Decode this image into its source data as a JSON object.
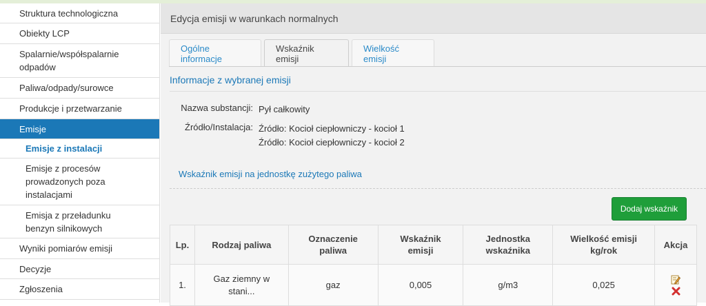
{
  "sidebar": {
    "items": [
      {
        "label": "Struktura technologiczna"
      },
      {
        "label": "Obiekty LCP"
      },
      {
        "label": "Spalarnie/współspalarnie\nodpadów"
      },
      {
        "label": "Paliwa/odpady/surowce"
      },
      {
        "label": "Produkcje i przetwarzanie"
      },
      {
        "label": "Emisje"
      },
      {
        "label": "Emisje z instalacji"
      },
      {
        "label": "Emisje z procesów\nprowadzonych poza\ninstalacjami"
      },
      {
        "label": "Emisja z przeładunku\nbenzyn silnikowych"
      },
      {
        "label": "Wyniki pomiarów emisji"
      },
      {
        "label": "Decyzje"
      },
      {
        "label": "Zgłoszenia"
      }
    ]
  },
  "main": {
    "header_title": "Edycja emisji w warunkach normalnych",
    "tabs": [
      {
        "label": "Ogólne informacje"
      },
      {
        "label": "Wskaźnik emisji"
      },
      {
        "label": "Wielkość emisji"
      }
    ],
    "section_title": "Informacje z wybranej emisji",
    "substance_label": "Nazwa substancji:",
    "substance_value": "Pył całkowity",
    "source_label": "Źródło/Instalacja:",
    "sources": [
      "Źródło: Kocioł ciepłowniczy - kocioł 1",
      "Źródło: Kocioł ciepłowniczy - kocioł 2"
    ],
    "subsection_title": "Wskaźnik emisji na jednostkę zużytego paliwa",
    "add_button": "Dodaj wskaźnik",
    "table": {
      "headers": [
        "Lp.",
        "Rodzaj paliwa",
        "Oznaczenie\npaliwa",
        "Wskaźnik\nemisji",
        "Jednostka\nwskaźnika",
        "Wielkość emisji\nkg/rok",
        "Akcja"
      ],
      "rows": [
        [
          "1.",
          "Gaz ziemny w\nstani...",
          "gaz",
          "0,005",
          "g/m3",
          "0,025"
        ]
      ]
    }
  },
  "colors": {
    "accent": "#1b78b7",
    "button_green": "#1f9e3a",
    "delete_red": "#d32f2f"
  },
  "icons": {
    "edit": "edit-icon",
    "delete": "delete-icon"
  }
}
